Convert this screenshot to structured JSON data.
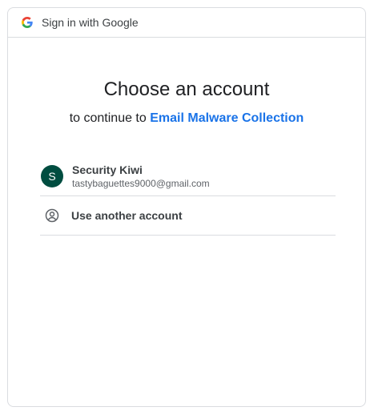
{
  "header": {
    "text": "Sign in with Google",
    "icon": "google-g-icon"
  },
  "main": {
    "title": "Choose an account",
    "subtitle_prefix": "to continue to",
    "app_name": "Email Malware Collection"
  },
  "accounts": [
    {
      "initial": "S",
      "name": "Security Kiwi",
      "email": "tastybaguettes9000@gmail.com",
      "avatar_color": "#004d40"
    }
  ],
  "use_another": {
    "label": "Use another account",
    "icon": "account-circle-icon"
  },
  "colors": {
    "link": "#1a73e8",
    "border": "#dadce0",
    "text": "#202124"
  }
}
